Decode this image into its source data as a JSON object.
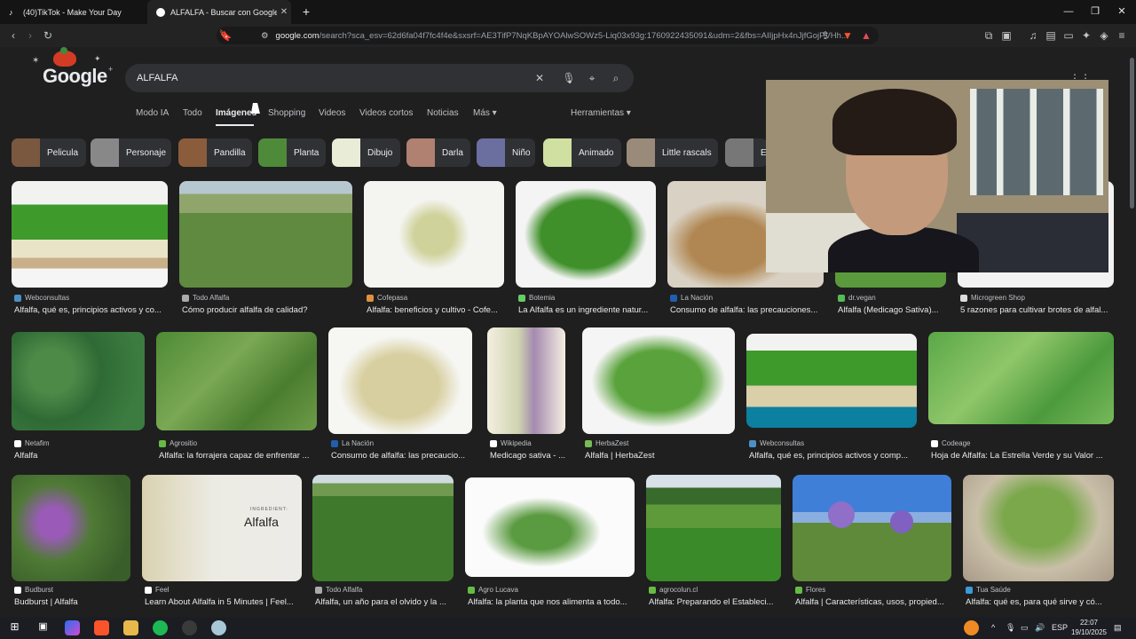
{
  "browser": {
    "tabs": [
      {
        "title": "(40)TikTok - Make Your Day"
      },
      {
        "title": "ALFALFA - Buscar con Google"
      }
    ],
    "url_domain": "google.com",
    "url_rest": "/search?sca_esv=62d6fa04f7fc4f4e&sxsrf=AE3TifP7NqKBpAYOAlwSOWz5-Liq03x93g:1760922435091&udm=2&fbs=AIIjpHx4nJjfGojPVHh..."
  },
  "google": {
    "logo": "Google",
    "query": "ALFALFA",
    "tabs": [
      "Modo IA",
      "Todo",
      "Imágenes",
      "Shopping",
      "Videos",
      "Videos cortos",
      "Noticias",
      "Más ▾"
    ],
    "tools": "Herramientas ▾",
    "chips": [
      "Pelicula",
      "Personaje",
      "Pandilla",
      "Planta",
      "Dibujo",
      "Darla",
      "Niño",
      "Animado",
      "Little rascals",
      "E"
    ]
  },
  "results": [
    {
      "source": "Webconsultas",
      "title": "Alfalfa, qué es, principios activos y co..."
    },
    {
      "source": "Todo Alfalfa",
      "title": "Cómo producir alfalfa de calidad?"
    },
    {
      "source": "Cofepasa",
      "title": "Alfalfa: beneficios y cultivo - Cofe..."
    },
    {
      "source": "Botemia",
      "title": "La Alfalfa es un ingrediente natur..."
    },
    {
      "source": "La Nación",
      "title": "Consumo de alfalfa: las precauciones..."
    },
    {
      "source": "dr.vegan",
      "title": "Alfalfa (Medicago Sativa)..."
    },
    {
      "source": "Microgreen Shop",
      "title": "5 razones para cultivar brotes de alfal..."
    },
    {
      "source": "Netafim",
      "title": "Alfalfa"
    },
    {
      "source": "Agrositio",
      "title": "Alfalfa: la forrajera capaz de enfrentar ..."
    },
    {
      "source": "La Nación",
      "title": "Consumo de alfalfa: las precaucio..."
    },
    {
      "source": "Wikipedia",
      "title": "Medicago sativa - ..."
    },
    {
      "source": "HerbaZest",
      "title": "Alfalfa | HerbaZest"
    },
    {
      "source": "Webconsultas",
      "title": "Alfalfa, qué es, principios activos y comp..."
    },
    {
      "source": "Codeage",
      "title": "Hoja de Alfalfa: La Estrella Verde y su Valor ..."
    },
    {
      "source": "Budburst",
      "title": "Budburst | Alfalfa"
    },
    {
      "source": "Feel",
      "title": "Learn About Alfalfa in 5 Minutes | Feel..."
    },
    {
      "source": "Todo Alfalfa",
      "title": "Alfalfa, un año para el olvido y la ..."
    },
    {
      "source": "Agro Lucava",
      "title": "Alfalfa: la planta que nos alimenta a todo..."
    },
    {
      "source": "agrocolun.cl",
      "title": "Alfalfa: Preparando el Estableci..."
    },
    {
      "source": "Flores",
      "title": "Alfalfa | Características, usos, propied..."
    },
    {
      "source": "Tua Saúde",
      "title": "Alfalfa: qué es, para qué sirve y có..."
    }
  ],
  "image_texts": {
    "feel_label": "INGREDIENT:",
    "feel_word": "Alfalfa"
  },
  "taskbar": {
    "lang": "ESP",
    "time": "22:07",
    "date": "19/10/2025"
  }
}
